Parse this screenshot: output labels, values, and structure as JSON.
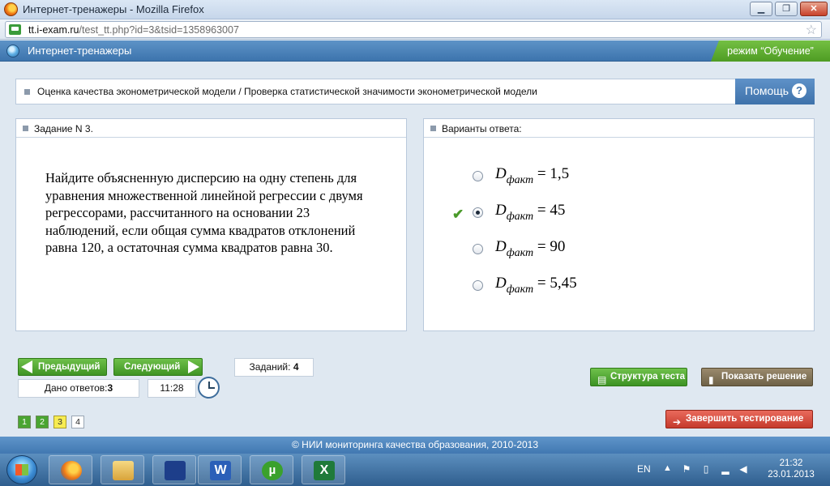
{
  "window": {
    "title": "Интернет-тренажеры - Mozilla Firefox",
    "minimize": "▁",
    "maximize": "❐",
    "close": "✕"
  },
  "browser": {
    "url_host": "tt.i-exam.ru",
    "url_path": "/test_tt.php?id=3&tsid=1358963007",
    "bookmark_star": "☆"
  },
  "header": {
    "app_title": "Интернет-тренажеры",
    "mode_label": "режим “Обучение”",
    "accent_color": "#4a80b8",
    "mode_color": "#5aa52c"
  },
  "breadcrumb": {
    "text": "Оценка качества эконометрической модели / Проверка статистической значимости эконометрической модели",
    "help_label": "Помощь",
    "help_icon": "?"
  },
  "task": {
    "title": "Задание N 3.",
    "question": "Найдите объясненную дисперсию на одну степень для уравнения множественной линейной регрессии с двумя регрессорами, рассчитанного на основании 23 наблюдений, если общая сумма квадратов отклонений равна 120, а остаточная сумма квадратов равна 30."
  },
  "answers": {
    "title": "Варианты ответа:",
    "symbol": "D",
    "subscript": "факт",
    "options": [
      {
        "value": "= 1,5",
        "selected": false
      },
      {
        "value": "= 45",
        "selected": true
      },
      {
        "value": "= 90",
        "selected": false
      },
      {
        "value": "= 5,45",
        "selected": false
      }
    ],
    "check_icon": "✔"
  },
  "controls": {
    "prev_label": "Предыдущий",
    "next_label": "Следующий",
    "answers_given_label": "Дано ответов:",
    "answers_given_value": "3",
    "timer": "11:28",
    "tasks_label": "Заданий:",
    "tasks_value": "4",
    "pages": [
      {
        "label": "1",
        "state": "done"
      },
      {
        "label": "2",
        "state": "done"
      },
      {
        "label": "3",
        "state": "current"
      },
      {
        "label": "4",
        "state": "todo"
      }
    ],
    "structure_label": "Структура теста",
    "solution_label": "Показать решение",
    "finish_label": "Завершить тестирование"
  },
  "footer": {
    "text": "© НИИ мониторинга качества образования, 2010-2013"
  },
  "taskbar": {
    "word_letter": "W",
    "utorrent_letter": "µ",
    "excel_letter": "X",
    "lang": "EN",
    "time": "21:32",
    "date": "23.01.2013"
  }
}
